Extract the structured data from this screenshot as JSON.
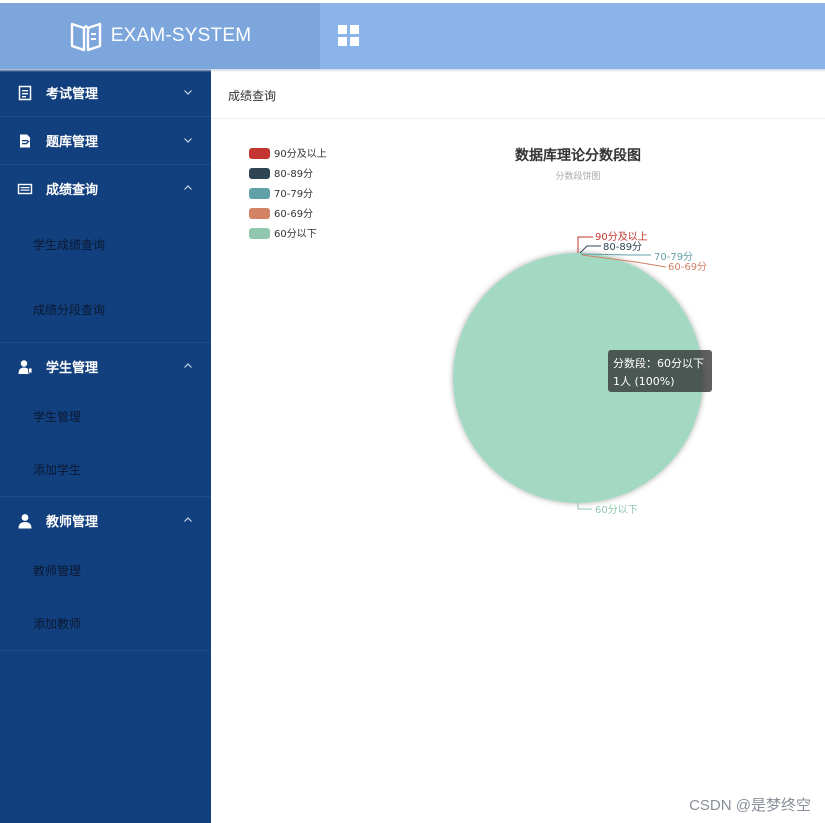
{
  "header": {
    "brand_title": "EXAM-SYSTEM",
    "brand_color": "#7da6dd",
    "bar_color": "#8bb4ea"
  },
  "sidebar": {
    "bg_color": "#123f7e",
    "groups": [
      {
        "label": "考试管理",
        "icon": "clipboard-icon",
        "expanded": false,
        "items": []
      },
      {
        "label": "题库管理",
        "icon": "document-edit-icon",
        "expanded": false,
        "items": []
      },
      {
        "label": "成绩查询",
        "icon": "keyboard-icon",
        "expanded": true,
        "items": [
          "学生成绩查询",
          "成绩分段查询"
        ]
      },
      {
        "label": "学生管理",
        "icon": "student-icon",
        "expanded": true,
        "items": [
          "学生管理",
          "添加学生"
        ]
      },
      {
        "label": "教师管理",
        "icon": "person-icon",
        "expanded": true,
        "items": [
          "教师管理",
          "添加教师"
        ]
      }
    ]
  },
  "main": {
    "breadcrumb": "成绩查询"
  },
  "chart_data": {
    "type": "pie",
    "title": "数据库理论分数段图",
    "subtitle": "分数段饼图",
    "legend_position": "top-left",
    "categories": [
      "90分及以上",
      "80-89分",
      "70-79分",
      "60-69分",
      "60分以下"
    ],
    "values": [
      0,
      0,
      0,
      0,
      1
    ],
    "colors": [
      "#c23531",
      "#2f4554",
      "#61a0a8",
      "#d48265",
      "#91c7ae"
    ],
    "tooltip": {
      "line1": "分数段：60分以下",
      "line2": "1人 (100%)"
    }
  },
  "watermark": "CSDN @是梦终空"
}
